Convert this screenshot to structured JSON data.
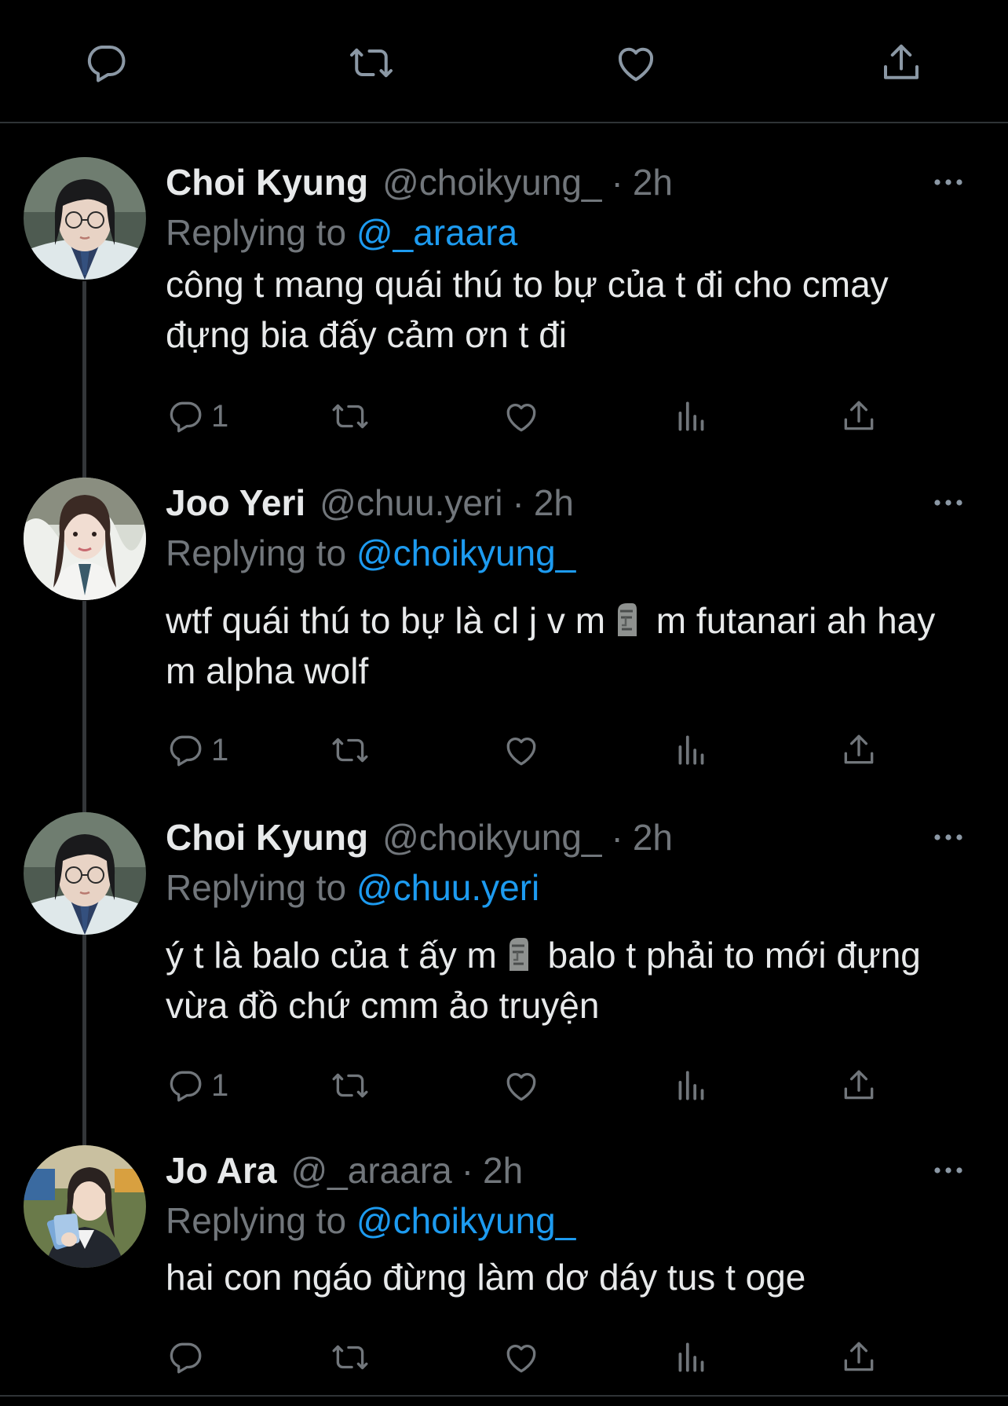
{
  "top_actions": [
    "reply-icon",
    "retweet-icon",
    "like-icon",
    "share-icon"
  ],
  "tweets": [
    {
      "name": "Choi Kyung",
      "handle": "@choikyung_",
      "dot": "·",
      "time": "2h",
      "reply_prefix": "Replying to",
      "reply_to": "@_araara",
      "text_parts": [
        "công t mang quái thú to bự của t đi cho cmay đựng bia đấy cảm ơn t đi"
      ],
      "reply_count": "1"
    },
    {
      "name": "Joo Yeri",
      "handle": "@chuu.yeri",
      "dot": "·",
      "time": "2h",
      "reply_prefix": "Replying to",
      "reply_to": "@choikyung_",
      "text_parts": [
        "wtf quái thú to bự là cl j v m",
        " m futanari ah hay m alpha wolf"
      ],
      "reply_count": "1"
    },
    {
      "name": "Choi Kyung",
      "handle": "@choikyung_",
      "dot": "·",
      "time": "2h",
      "reply_prefix": "Replying to",
      "reply_to": "@chuu.yeri",
      "text_parts": [
        "ý t là balo của t ấy m",
        " balo t phải to mới đựng vừa đồ chứ cmm ảo truyện"
      ],
      "reply_count": "1"
    },
    {
      "name": "Jo Ara",
      "handle": "@_araara",
      "dot": "·",
      "time": "2h",
      "reply_prefix": "Replying to",
      "reply_to": "@choikyung_",
      "text_parts": [
        "hai con ngáo đừng làm dơ dáy tus t oge"
      ],
      "reply_count": ""
    }
  ],
  "colors": {
    "background": "#000000",
    "text": "#e7e9ea",
    "secondary": "#71767b",
    "link": "#1d9bf0",
    "divider": "#2f3336"
  }
}
